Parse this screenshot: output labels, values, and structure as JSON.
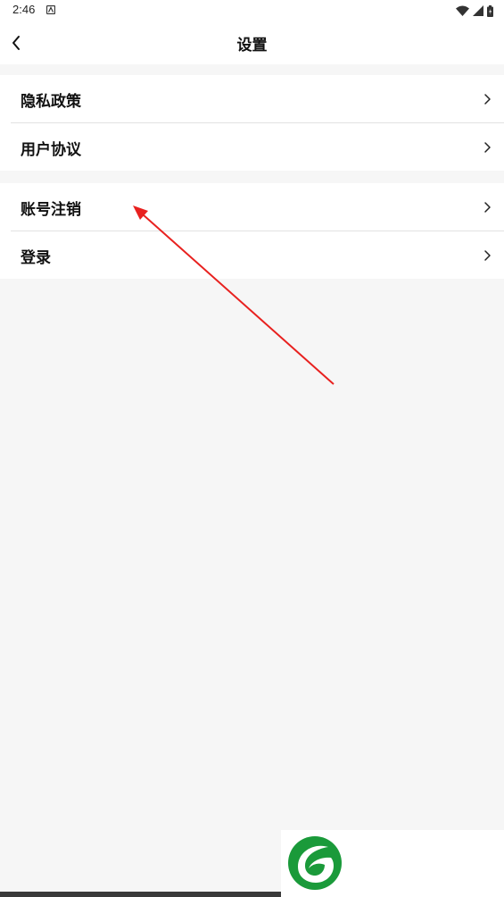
{
  "status_bar": {
    "time": "2:46"
  },
  "header": {
    "title": "设置"
  },
  "settings": {
    "group1": [
      {
        "label": "隐私政策"
      },
      {
        "label": "用户协议"
      }
    ],
    "group2": [
      {
        "label": "账号注销"
      },
      {
        "label": "登录"
      }
    ]
  },
  "colors": {
    "background": "#f6f6f6",
    "surface": "#ffffff",
    "annotation_arrow": "#e8211f",
    "logo_green": "#1a9a3a"
  }
}
